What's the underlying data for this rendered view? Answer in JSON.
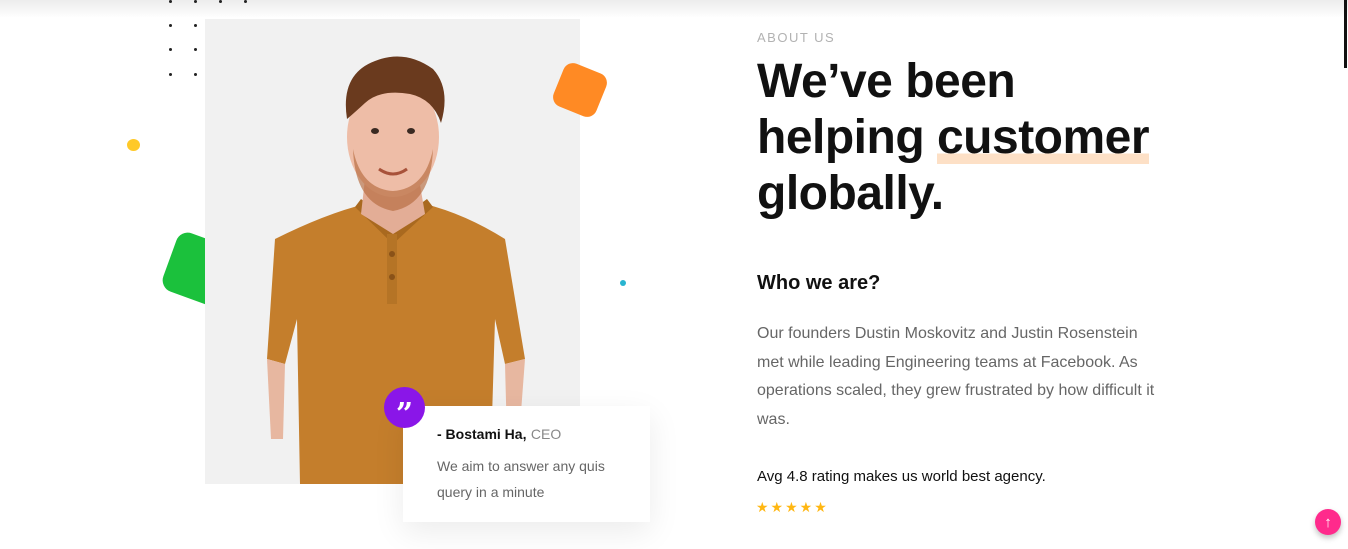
{
  "about": {
    "eyebrow": "ABOUT US",
    "headline_pre": "We’ve been helping ",
    "headline_highlight": "customer",
    "headline_post": " globally.",
    "subhead": "Who we are?",
    "body": "Our founders Dustin Moskovitz and Justin Rosenstein met while leading Engineering teams at Facebook. As operations scaled, they grew frustrated by how difficult it was.",
    "rating_text": "Avg 4.8 rating makes us world best agency.",
    "stars": "★★★★★",
    "rating_stars": 5
  },
  "quote": {
    "icon": "quote-icon",
    "icon_glyph": "”",
    "author": "- Bostami Ha,",
    "role": "CEO",
    "text": "We aim to answer any quis query in a minute"
  },
  "scroll_top": {
    "icon": "arrow-up-icon",
    "glyph": "↑"
  },
  "colors": {
    "accent_orange": "#ff8a24",
    "accent_green": "#1bc13c",
    "accent_purple": "#8a16e8",
    "accent_pink": "#ff2a8c",
    "star_yellow": "#ffb712",
    "highlight": "#fde0c6"
  }
}
